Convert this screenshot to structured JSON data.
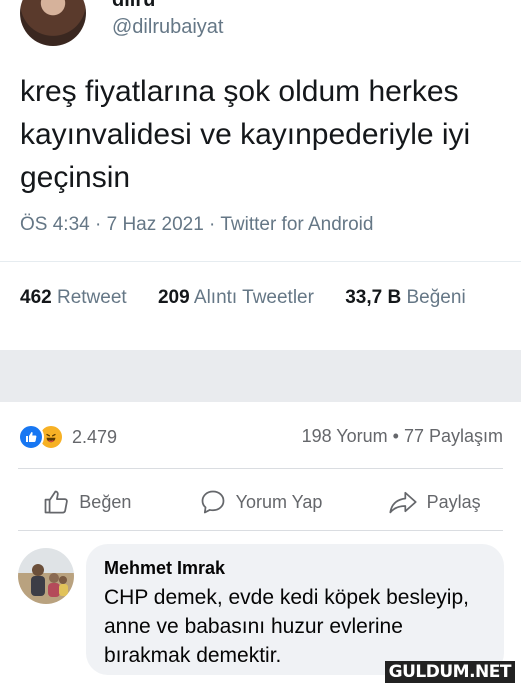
{
  "tweet": {
    "display_name": "dilru",
    "handle": "@dilrubaiyat",
    "text": "kreş fiyatlarına şok oldum herkes kayınvalidesi ve kayınpederiyle iyi geçinsin",
    "meta": "ÖS 4:34 · 7 Haz 2021 · Twitter for Android",
    "stats": {
      "retweets_count": "462",
      "retweets_label": "Retweet",
      "quotes_count": "209",
      "quotes_label": "Alıntı Tweetler",
      "likes_count": "33,7 B",
      "likes_label": "Beğeni"
    }
  },
  "facebook": {
    "reaction_count": "2.479",
    "counts": "198 Yorum • 77 Paylaşım",
    "actions": {
      "like": "Beğen",
      "comment": "Yorum Yap",
      "share": "Paylaş"
    },
    "comment": {
      "author": "Mehmet Imrak",
      "text": "CHP demek, evde kedi köpek besleyip, anne ve babasını huzur evlerine bırakmak demektir."
    }
  },
  "watermark": "GULDUM.NET",
  "colors": {
    "twitter_gray": "#657786",
    "fb_blue": "#1877f2",
    "fb_haha": "#f7b125",
    "fb_gray": "#65676b",
    "separator": "#e9ebee"
  },
  "icons": [
    "like-reaction-icon",
    "haha-reaction-icon",
    "thumbs-up-icon",
    "comment-icon",
    "share-icon"
  ]
}
